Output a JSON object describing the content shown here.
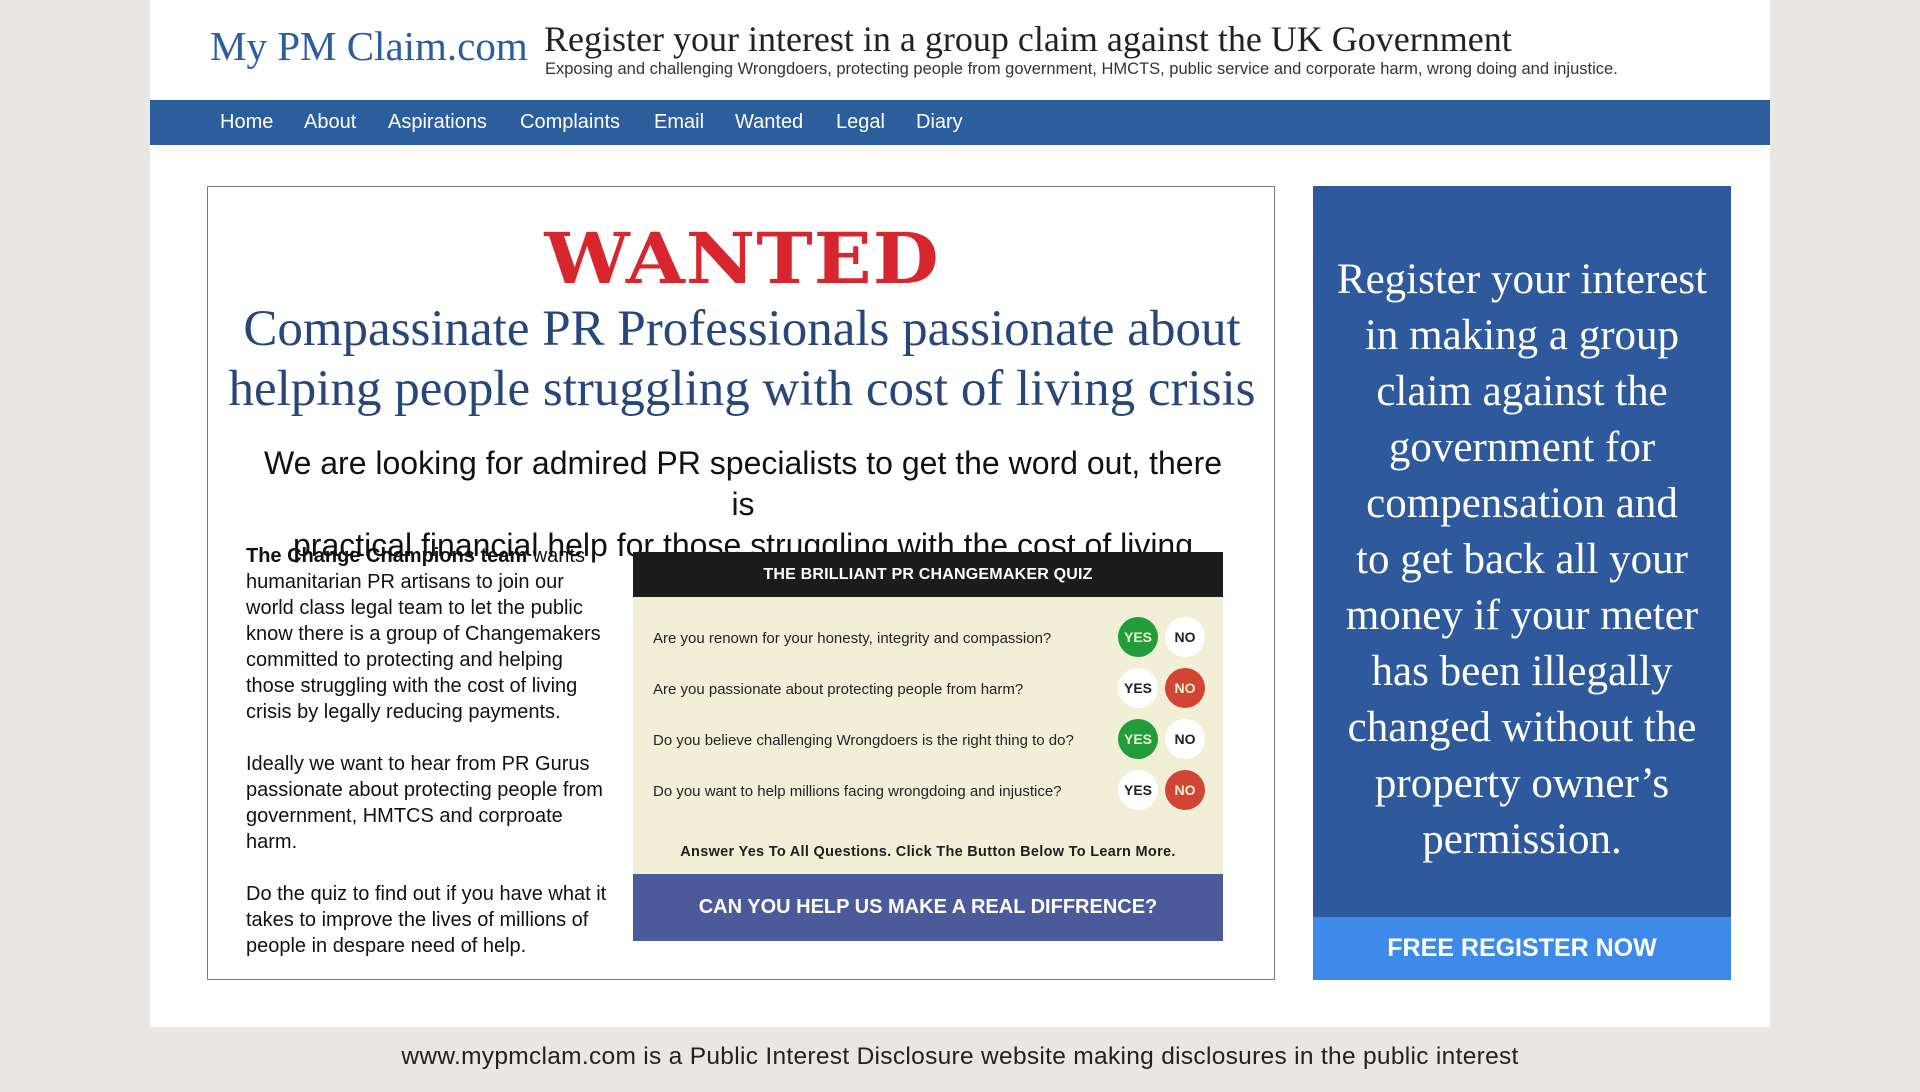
{
  "header": {
    "logo": "My PM Claim.com",
    "title": "Register your interest in a group claim against the UK Government",
    "subtitle": "Exposing and challenging Wrongdoers, protecting people from government, HMCTS, public service and corporate harm, wrong doing and injustice."
  },
  "nav": {
    "items": [
      "Home",
      "About",
      "Aspirations",
      "Complaints",
      "Email",
      "Wanted",
      "Legal",
      "Diary"
    ]
  },
  "ad": {
    "wanted": "WANTED",
    "headline_line1": "Compassinate PR Professionals passionate about",
    "headline_line2": "helping people struggling with cost of living crisis",
    "subheadline_line1": "We are looking for admired PR specialists to get the word out, there is",
    "subheadline_line2": "practical financial help for those struggling with the cost of living crisis.",
    "team_name": "The Change Champions team",
    "paragraph1_rest": " wants humanitarian PR artisans to join our world class legal team to let the public know there is a group of Changemakers committed to protecting and helping those struggling with the cost of living crisis by legally reducing payments.",
    "paragraph2": "Ideally we want to hear from PR Gurus passionate about protecting people from government, HMTCS and corproate harm.",
    "paragraph3": "Do the quiz to find out if you have what it takes to improve the lives of millions of people in despare need of help."
  },
  "quiz": {
    "title": "THE BRILLIANT PR CHANGEMAKER QUIZ",
    "yes_label": "YES",
    "no_label": "NO",
    "questions": [
      {
        "text": "Are you renown for your honesty, integrity and compassion?",
        "highlight": "yes"
      },
      {
        "text": "Are you passionate about protecting people from harm?",
        "highlight": "no"
      },
      {
        "text": "Do you believe challenging Wrongdoers is the right thing to do?",
        "highlight": "yes"
      },
      {
        "text": "Do you want to help millions facing wrongdoing and injustice?",
        "highlight": "no"
      }
    ],
    "note": "Answer Yes To All Questions. Click The Button Below To Learn More.",
    "cta": "CAN YOU HELP US MAKE A REAL DIFFRENCE?"
  },
  "side": {
    "text_lines": [
      "Register your interest",
      "in making a group",
      "claim against the",
      "government for",
      "compensation and",
      "to get back all your",
      "money if your meter",
      "has been illegally",
      "changed without the",
      "property owner’s",
      "permission."
    ],
    "cta": "FREE REGISTER NOW"
  },
  "footer": {
    "text": "www.mypmclam.com is a Public Interest Disclosure website making disclosures in the public interest"
  },
  "colors": {
    "nav_bg": "#2c5d9c",
    "logo": "#2b5da0",
    "wanted_red": "#d7262e",
    "headline": "#26477a",
    "quiz_bg": "#f1f0d6",
    "quiz_cta": "#4b5a9b",
    "yes_green": "#239c3b",
    "no_red": "#d24535",
    "side_bg": "#2e5a9d",
    "side_cta": "#3d8ae8"
  }
}
